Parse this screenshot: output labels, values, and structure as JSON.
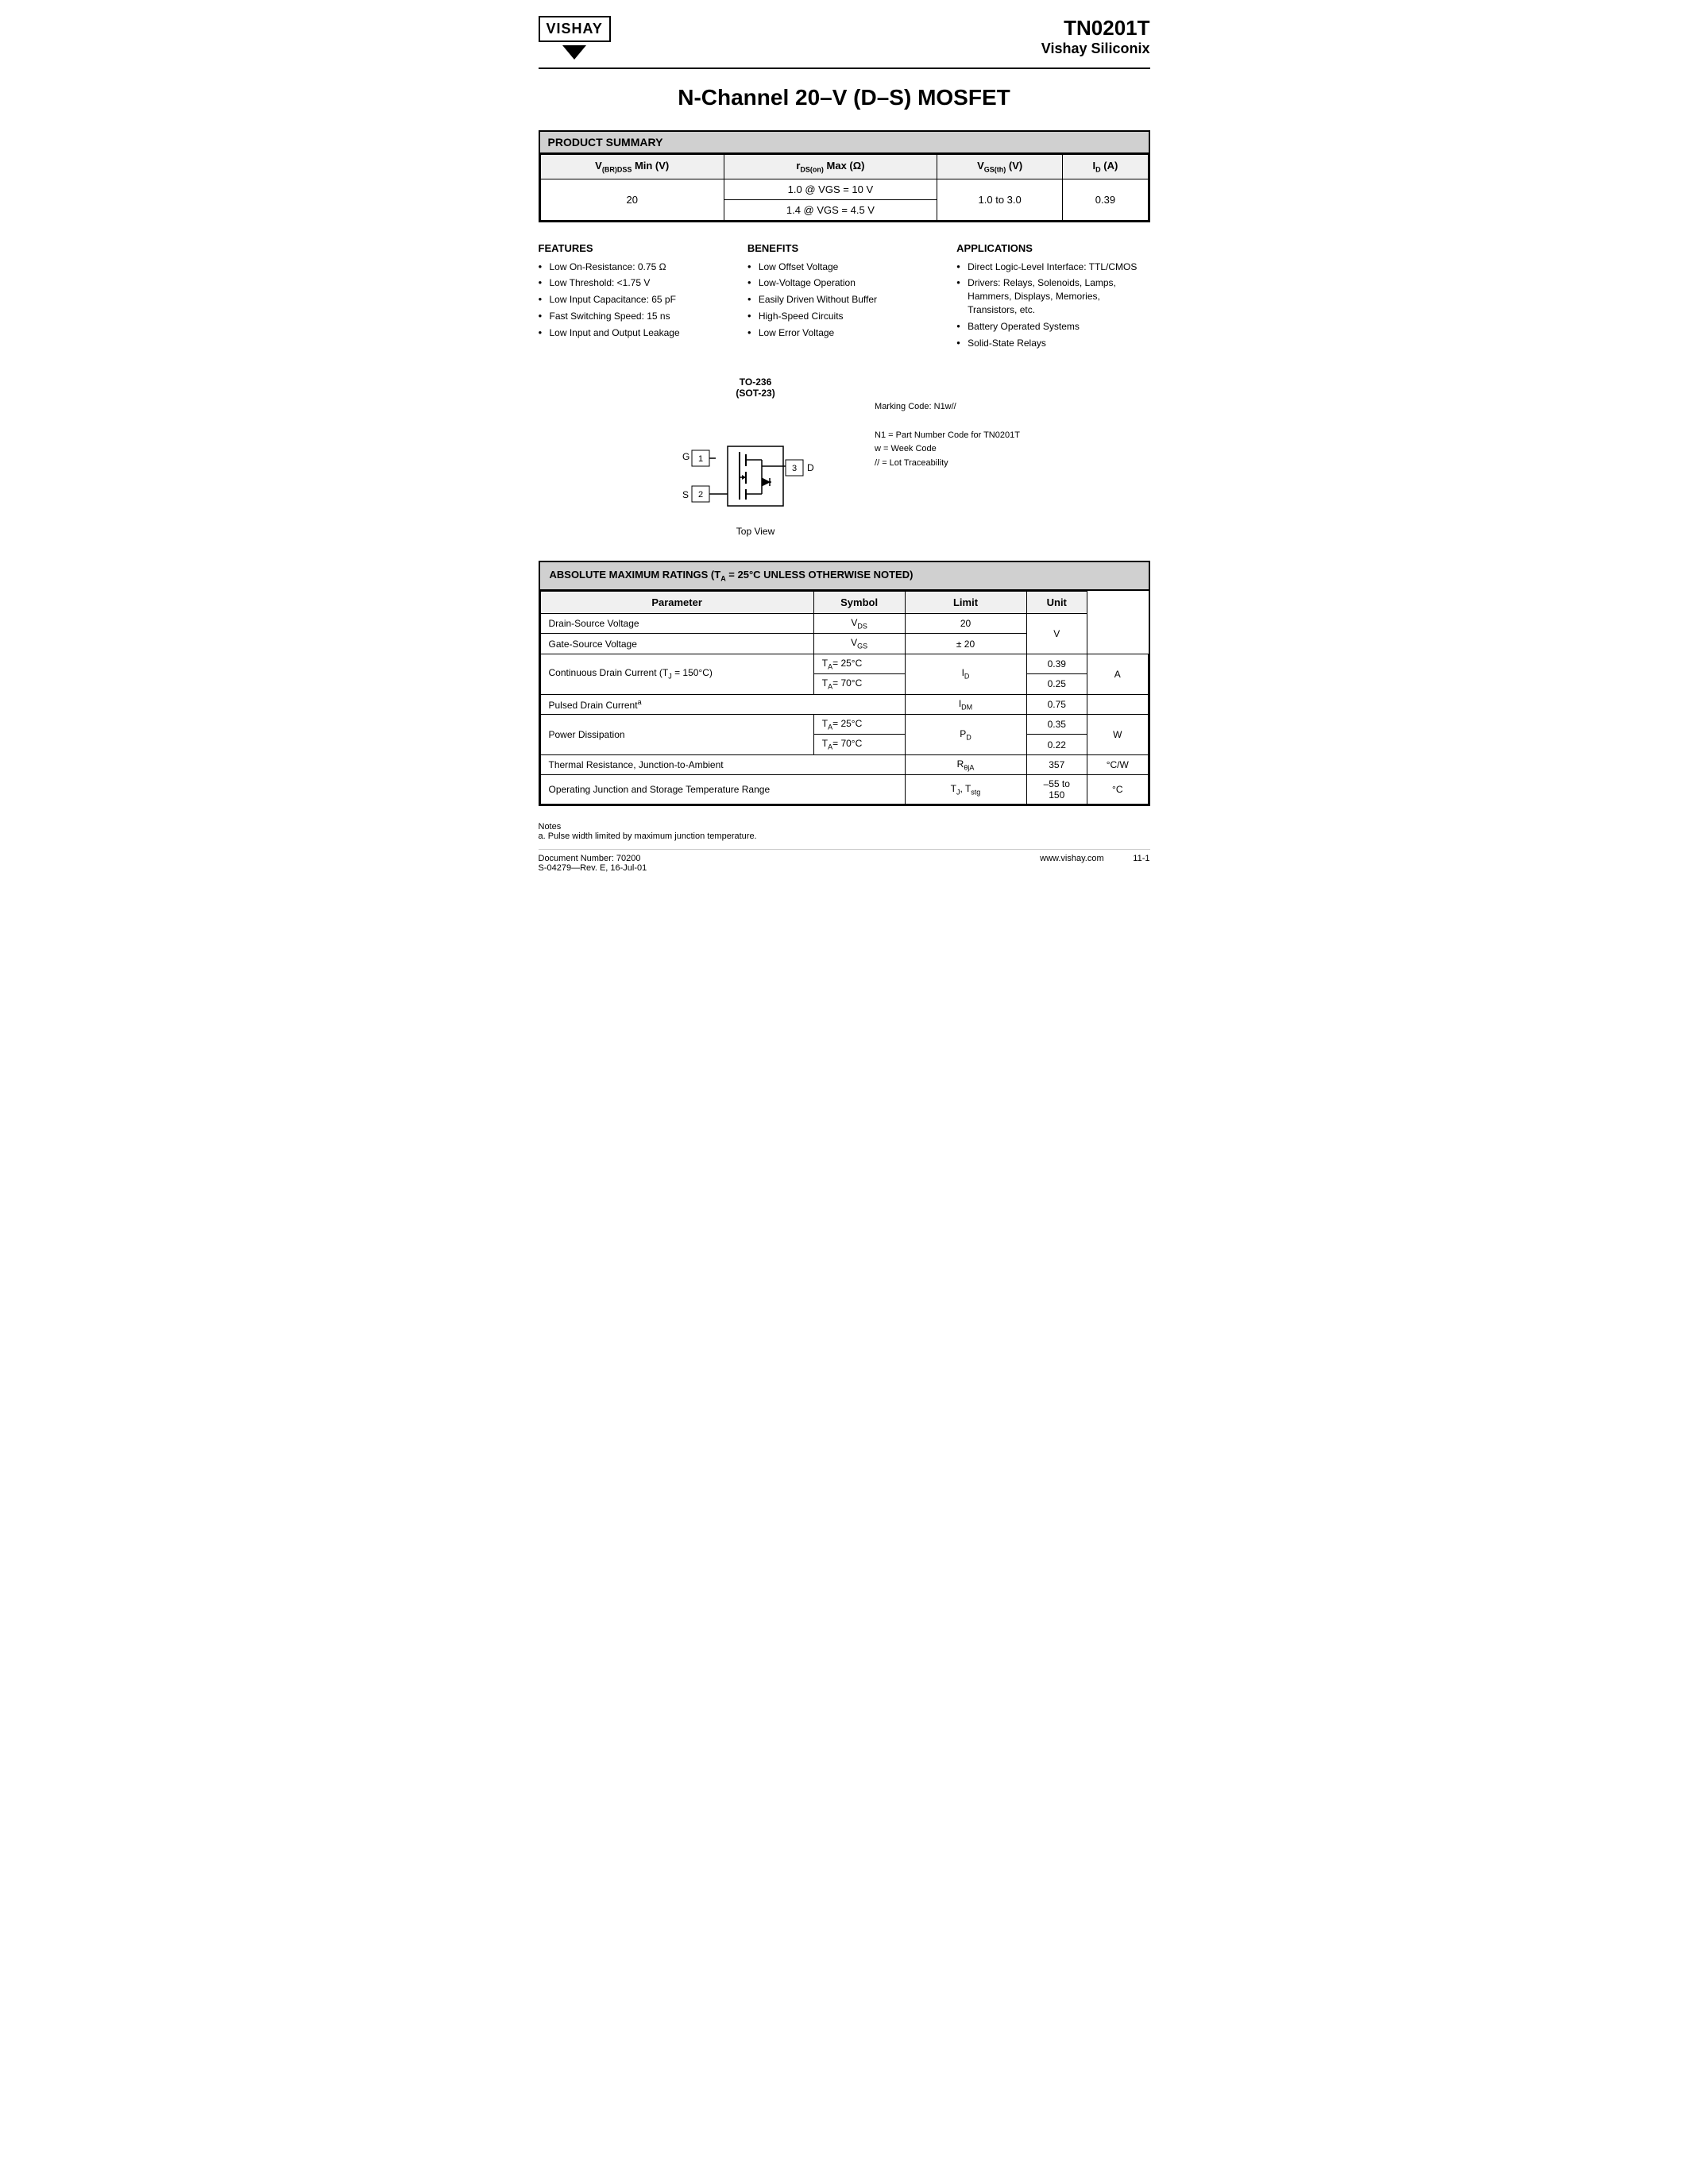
{
  "header": {
    "logo_text": "VISHAY",
    "part_number": "TN0201T",
    "company_name": "Vishay Siliconix"
  },
  "title": "N-Channel 20–V (D–S) MOSFET",
  "product_summary": {
    "title": "PRODUCT SUMMARY",
    "columns": [
      "V(BR)DSS Min (V)",
      "rDS(on) Max (Ω)",
      "VGS(th) (V)",
      "ID (A)"
    ],
    "row": {
      "vbrdss": "20",
      "rds_row1": "1.0 @ VGS = 10 V",
      "rds_row2": "1.4 @ VGS = 4.5 V",
      "vgsth": "1.0  to 3.0",
      "id": "0.39"
    }
  },
  "features": {
    "title": "FEATURES",
    "items": [
      "Low On-Resistance:  0.75 Ω",
      "Low Threshold:  <1.75 V",
      "Low Input Capacitance:  65 pF",
      "Fast Switching Speed:  15 ns",
      "Low Input and Output Leakage"
    ]
  },
  "benefits": {
    "title": "BENEFITS",
    "items": [
      "Low Offset Voltage",
      "Low-Voltage Operation",
      "Easily Driven Without Buffer",
      "High-Speed Circuits",
      "Low Error Voltage"
    ]
  },
  "applications": {
    "title": "APPLICATIONS",
    "items": [
      "Direct Logic-Level Interface:  TTL/CMOS",
      "Drivers:  Relays, Solenoids, Lamps, Hammers, Displays, Memories, Transistors, etc.",
      "Battery Operated Systems",
      "Solid-State Relays"
    ]
  },
  "diagram": {
    "package_line1": "TO-236",
    "package_line2": "(SOT-23)",
    "top_view": "Top View",
    "marking_code": "Marking Code:  N1w//",
    "marking_n1": "N1 = Part Number Code for TN0201T",
    "marking_w": "w = Week Code",
    "marking_ll": "// = Lot Traceability"
  },
  "ratings": {
    "title": "ABSOLUTE MAXIMUM RATINGS (TA = 25°C UNLESS OTHERWISE NOTED)",
    "columns": [
      "Parameter",
      "Symbol",
      "Limit",
      "Unit"
    ],
    "rows": [
      {
        "param": "Drain-Source Voltage",
        "sub_param": "",
        "symbol": "VDS",
        "limit": "20",
        "unit": "V",
        "rowspan": 1
      },
      {
        "param": "Gate-Source Voltage",
        "sub_param": "",
        "symbol": "VGS",
        "limit": "± 20",
        "unit": "V",
        "rowspan": 1
      },
      {
        "param": "Continuous Drain Current (TJ = 150°C)",
        "sub_param": "TA= 25°C",
        "symbol": "ID",
        "limit": "0.39",
        "unit": "A",
        "rowspan": 2
      },
      {
        "param": "",
        "sub_param": "TA= 70°C",
        "symbol": "",
        "limit": "0.25",
        "unit": "",
        "rowspan": 0
      },
      {
        "param": "Pulsed Drain Currentª",
        "sub_param": "",
        "symbol": "IDM",
        "limit": "0.75",
        "unit": "",
        "rowspan": 1
      },
      {
        "param": "Power Dissipation",
        "sub_param": "TA= 25°C",
        "symbol": "PD",
        "limit": "0.35",
        "unit": "W",
        "rowspan": 2
      },
      {
        "param": "",
        "sub_param": "TA= 70°C",
        "symbol": "",
        "limit": "0.22",
        "unit": "",
        "rowspan": 0
      },
      {
        "param": "Thermal Resistance, Junction-to-Ambient",
        "sub_param": "",
        "symbol": "RθjA",
        "limit": "357",
        "unit": "°C/W",
        "rowspan": 1
      },
      {
        "param": "Operating Junction and Storage Temperature Range",
        "sub_param": "",
        "symbol": "TJ, Tstg",
        "limit": "–55 to 150",
        "unit": "°C",
        "rowspan": 1
      }
    ]
  },
  "notes": {
    "label": "Notes",
    "note_a": "a.   Pulse width limited by maximum junction temperature."
  },
  "footer": {
    "doc_number": "Document Number:  70200",
    "revision": "S-04279—Rev. E, 16-Jul-01",
    "website": "www.vishay.com",
    "page": "11-1"
  }
}
